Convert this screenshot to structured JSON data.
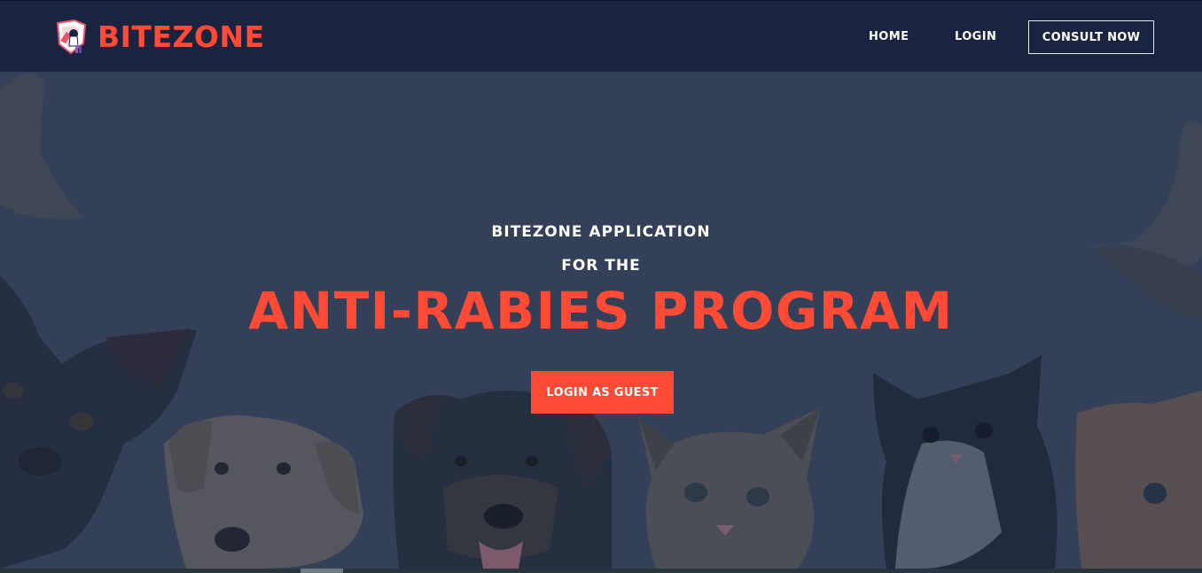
{
  "brand": {
    "name": "BITEZONE",
    "logo_icon": "shield-pet-logo-icon"
  },
  "nav": {
    "home": "HOME",
    "login": "LOGIN",
    "consult": "CONSULT NOW"
  },
  "hero": {
    "subtitle_line1": "BITEZONE APPLICATION",
    "subtitle_line2": "FOR THE",
    "title": "ANTI-RABIES PROGRAM",
    "cta": "LOGIN AS GUEST",
    "background_image": "puppies and kittens photo"
  },
  "colors": {
    "navbar": "#1a2440",
    "accent": "#ff4a36",
    "hero_background": "#384459",
    "text": "#ffffff"
  }
}
